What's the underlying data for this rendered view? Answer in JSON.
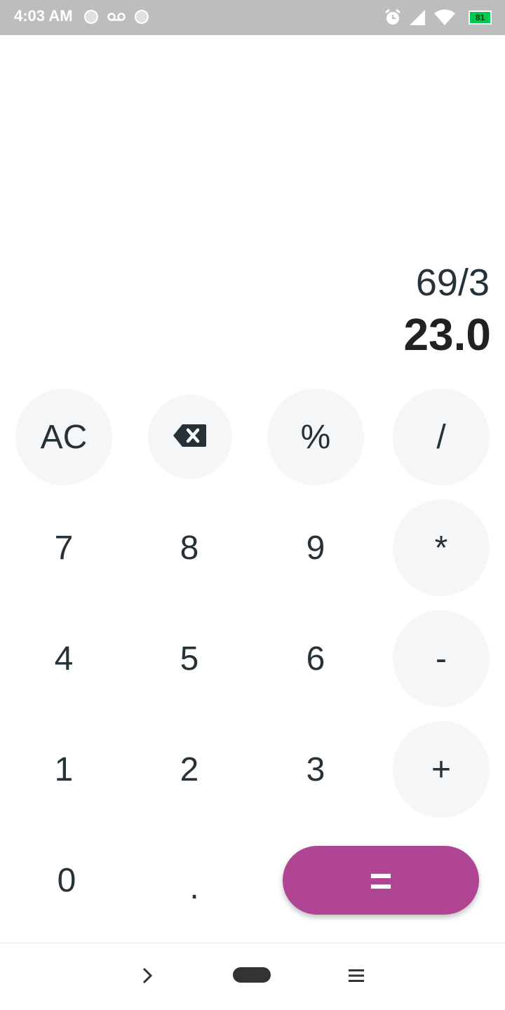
{
  "status_bar": {
    "time": "4:03 AM",
    "battery": "81",
    "icons": [
      "circle-icon",
      "voicemail-icon",
      "circle-icon",
      "alarm-icon",
      "signal-icon",
      "wifi-icon",
      "battery-icon"
    ]
  },
  "display": {
    "expression": "69/3",
    "result": "23.0"
  },
  "keys": {
    "clear": "AC",
    "percent": "%",
    "divide": "/",
    "multiply": "*",
    "subtract": "-",
    "add": "+",
    "equals": "=",
    "decimal": ".",
    "digits": [
      "0",
      "1",
      "2",
      "3",
      "4",
      "5",
      "6",
      "7",
      "8",
      "9"
    ]
  },
  "navigation": {
    "icons": [
      "chevron-right-icon",
      "home-pill-icon",
      "menu-icon"
    ]
  },
  "colors": {
    "accent": "#b04593",
    "key_bg": "#f4f6f8",
    "text": "#263238",
    "status_bar": "#bdbdbd"
  }
}
